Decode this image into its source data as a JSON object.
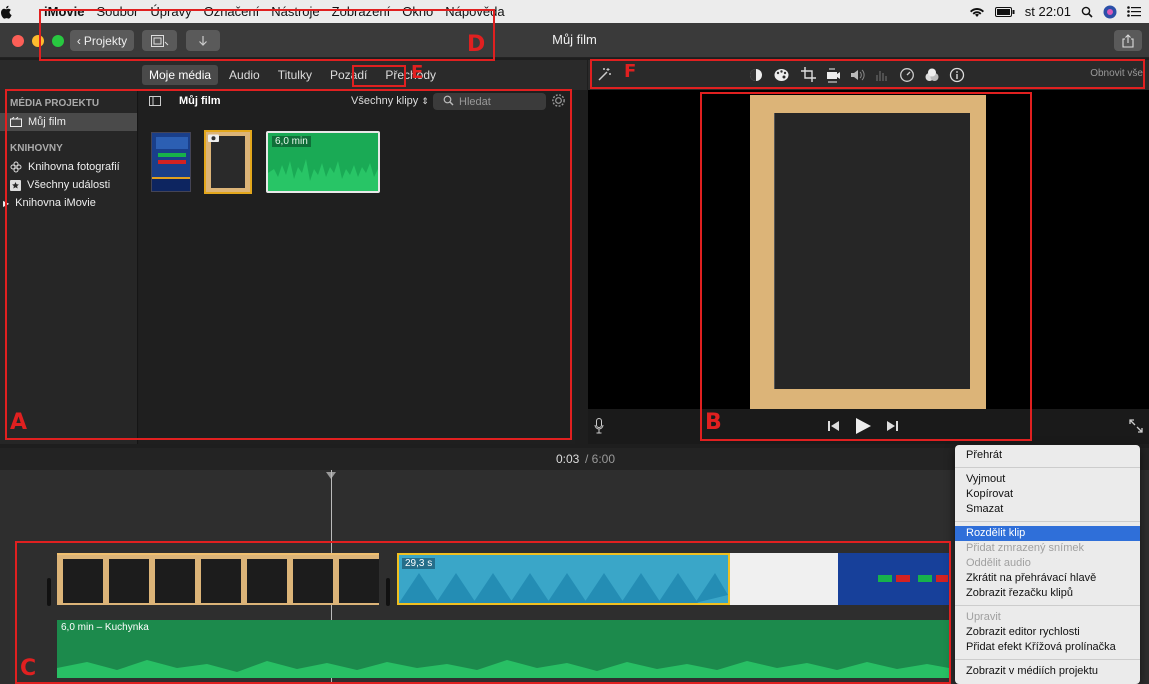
{
  "menubar": {
    "apple_icon": "apple-icon",
    "app": "iMovie",
    "items": [
      "Soubor",
      "Úpravy",
      "Označení",
      "Nástroje",
      "Zobrazení",
      "Okno",
      "Nápověda"
    ],
    "clock": "st 22:01"
  },
  "titlebar": {
    "projects_label": "Projekty",
    "title": "Můj film"
  },
  "browser": {
    "tabs": [
      "Moje média",
      "Audio",
      "Titulky",
      "Pozadí",
      "Přechody"
    ],
    "active_tab": "Moje média",
    "library_title": "Můj film",
    "filter": "Všechny klipy",
    "search_placeholder": "Hledat",
    "clip_duration": "6,0 min"
  },
  "sidebar": {
    "section_project": "MÉDIA PROJEKTU",
    "project_item": "Můj film",
    "section_libraries": "KNIHOVNY",
    "items": [
      "Knihovna fotografií",
      "Všechny události",
      "Knihovna iMovie"
    ]
  },
  "viewer": {
    "reset_label": "Obnovit vše"
  },
  "timeline": {
    "time_current": "0:03",
    "time_total": "/ 6:00",
    "clip_badge": "29,3 s",
    "audio_label": "6,0 min – Kuchynka"
  },
  "context_menu": {
    "play": "Přehrát",
    "cut": "Vyjmout",
    "copy": "Kopírovat",
    "delete": "Smazat",
    "split": "Rozdělit klip",
    "freeze": "Přidat zmrazený snímek",
    "detach_audio": "Oddělit audio",
    "trim_playhead": "Zkrátit na přehrávací hlavě",
    "show_trimmer": "Zobrazit řezačku klipů",
    "edit": "Upravit",
    "speed_editor": "Zobrazit editor rychlosti",
    "crossfade": "Přidat efekt Křížová prolínačka",
    "reveal": "Zobrazit v médiích projektu"
  },
  "annotations": {
    "a": "A",
    "b": "B",
    "c": "C",
    "d": "D",
    "e": "E",
    "f": "F",
    "color": "#e02020"
  }
}
